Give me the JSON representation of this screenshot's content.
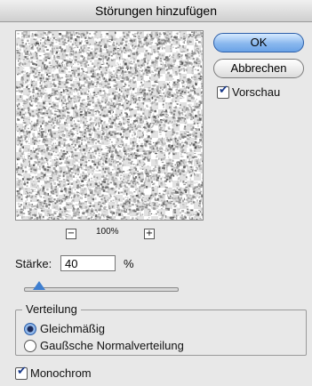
{
  "window": {
    "title": "Störungen hinzufügen"
  },
  "buttons": {
    "ok": "OK",
    "cancel": "Abbrechen"
  },
  "preview_checkbox": {
    "label": "Vorschau",
    "checked": true
  },
  "zoom": {
    "minus": "−",
    "plus": "+",
    "level": "100%"
  },
  "amount": {
    "label": "Stärke:",
    "value": "40",
    "unit": "%",
    "slider_fraction": 0.1
  },
  "distribution": {
    "legend": "Verteilung",
    "options": [
      {
        "label": "Gleichmäßig",
        "selected": true
      },
      {
        "label": "Gaußsche Normalverteilung",
        "selected": false
      }
    ]
  },
  "monochrome": {
    "label": "Monochrom",
    "checked": true
  },
  "colors": {
    "accent": "#3f7fd0"
  }
}
